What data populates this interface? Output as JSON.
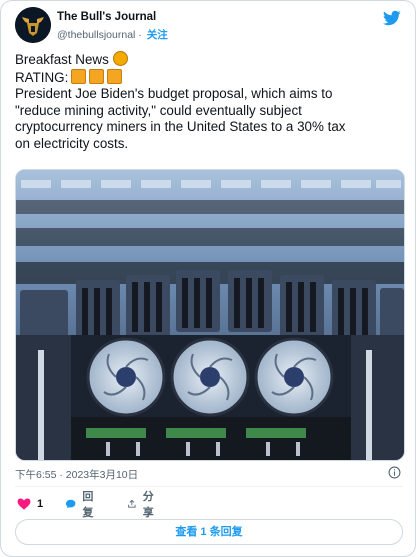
{
  "author": {
    "name": "The Bull's Journal",
    "handle": "@thebullsjournal",
    "separator": "·",
    "follow_label": "关注"
  },
  "tweet": {
    "line1": "Breakfast News",
    "line2": "RATING:",
    "line3": "President Joe Biden's budget proposal, which aims to",
    "line4": "\"reduce mining activity,\" could eventually subject",
    "line5": "cryptocurrency miners in the United States to a 30% tax",
    "line6": "on electricity costs."
  },
  "timestamp": "下午6:55 · 2023年3月10日",
  "actions": {
    "like_count": "1",
    "reply_label": "回复",
    "share_label": "分享"
  },
  "replies_button": "查看 1 条回复",
  "icons": [
    "twitter-bird-icon",
    "info-icon",
    "heart-icon",
    "reply-bubble-icon",
    "share-icon",
    "bitcoin-coin-emoji",
    "rating-box-emoji"
  ],
  "colors": {
    "accent": "#1d9bf0",
    "like": "#f91880",
    "muted": "#536471"
  }
}
